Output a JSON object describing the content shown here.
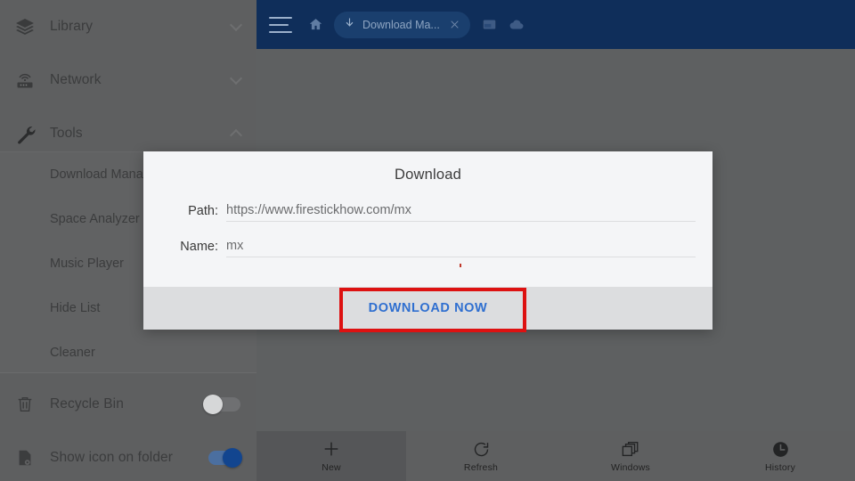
{
  "sidebar": {
    "sections": [
      {
        "label": "Library",
        "icon": "layers-icon",
        "chevron": "chevron-down-icon"
      },
      {
        "label": "Network",
        "icon": "router-icon",
        "chevron": "chevron-down-icon"
      },
      {
        "label": "Tools",
        "icon": "wrench-icon",
        "chevron": "chevron-up-icon"
      }
    ],
    "submenu": [
      {
        "label": "Download Manager"
      },
      {
        "label": "Space Analyzer"
      },
      {
        "label": "Music Player"
      },
      {
        "label": "Hide List"
      },
      {
        "label": "Cleaner"
      }
    ],
    "toggles": [
      {
        "label": "Recycle Bin",
        "icon": "trash-icon",
        "state": "off"
      },
      {
        "label": "Show icon on folder",
        "icon": "folder-eye-icon",
        "state": "on"
      }
    ]
  },
  "topbar": {
    "menu_icon": "hamburger-icon",
    "home_icon": "home-icon",
    "tab": {
      "icon": "download-arrow-icon",
      "title": "Download Ma...",
      "close_icon": "close-icon"
    },
    "window_icon": "window-icon",
    "cloud_icon": "cloud-icon",
    "background_color": "#0f2e5a"
  },
  "dialog": {
    "title": "Download",
    "path_label": "Path:",
    "path_value": "https://www.firestickhow.com/mx",
    "name_label": "Name:",
    "name_value": "mx",
    "download_button": "DOWNLOAD NOW",
    "button_text_color": "#2f6fd0",
    "highlight_color": "#dd1111"
  },
  "bottombar": {
    "items": [
      {
        "label": "New",
        "icon": "plus-icon",
        "active": true
      },
      {
        "label": "Refresh",
        "icon": "refresh-icon",
        "active": false
      },
      {
        "label": "Windows",
        "icon": "windows-stack-icon",
        "active": false
      },
      {
        "label": "History",
        "icon": "clock-icon",
        "active": false
      }
    ]
  }
}
